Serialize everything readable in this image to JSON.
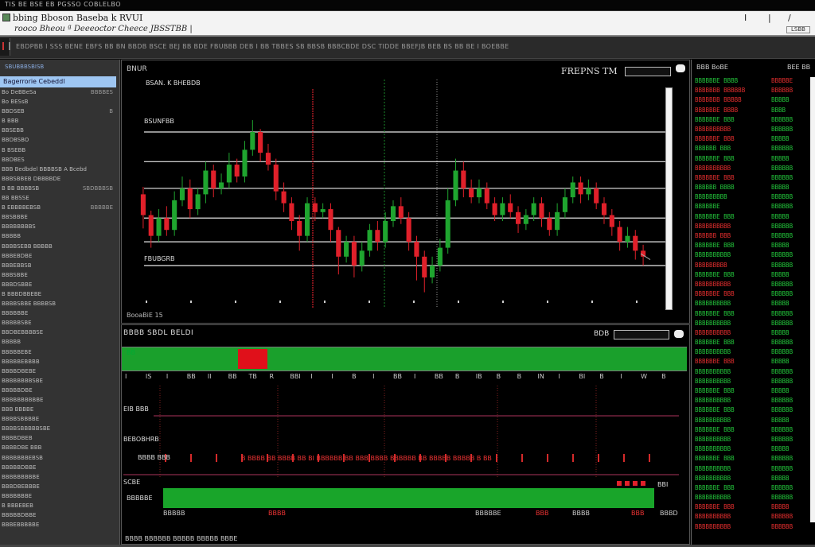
{
  "titlebar": {
    "title": "TIS  BE BSE EB PGSSO COBLELBO"
  },
  "menubar": {
    "app_name": "bbing Bboson  Baseba k  RVUI",
    "subtitle": "rooco  Bheou  ª  Deeeoctor  Cheece  JBSSTBB |",
    "win_controls": [
      "I",
      "|",
      "/"
    ],
    "small_box": "LSBB"
  },
  "toolbar": {
    "text": "EBDPBB  I  SSS  BENE  EBFS  BB  BN  BBDB  BSCE  BEJ  BB  BDE   FBUBBB  DEB   I  BB   TBBES  SB   BBSB  BBBCBDE  DSC  TIDDE  BBEFJB  BEB  BS  BB  BE  I  BOEBBE"
  },
  "sidebar": {
    "header": "SBUBBBSBISB",
    "selected": "Bagerrorie Cebeddl",
    "rows": [
      {
        "l": "Bo DeBBeSa",
        "r": "BBBBES"
      },
      {
        "l": "Bo BESsB",
        "r": ""
      },
      {
        "l": "BBDSEB",
        "r": "B"
      },
      {
        "l": "B BBB",
        "r": ""
      },
      {
        "l": "BBSEBB",
        "r": ""
      },
      {
        "l": "BBDBSBO",
        "r": ""
      },
      {
        "l": "B  BSEBB",
        "r": ""
      },
      {
        "l": "BBDBES",
        "r": ""
      },
      {
        "l": "BBB Bedbdel  BBBBSB  A Bcebd",
        "r": ""
      },
      {
        "l": "BBBSBBEB  DBBBBDE",
        "r": ""
      },
      {
        "l": "B BB BBBBSB",
        "r": "SBDBBBSB"
      },
      {
        "l": "BB BBSSE",
        "r": ""
      },
      {
        "l": "B EBBBBEBSB",
        "r": "BBBBBE"
      },
      {
        "l": "BBSBBBE",
        "r": ""
      },
      {
        "l": "BBBBBBBBS",
        "r": ""
      },
      {
        "l": "BBBBB",
        "r": ""
      },
      {
        "l": "BBBBSEBB  BBBBB",
        "r": ""
      },
      {
        "l": "BBBEBDBE",
        "r": ""
      },
      {
        "l": "BBBEBBSB",
        "r": ""
      },
      {
        "l": "BBBSBBE",
        "r": ""
      },
      {
        "l": "BBBDSBBE",
        "r": ""
      },
      {
        "l": "B BBBDBBEBE",
        "r": ""
      },
      {
        "l": "BBBBSBBE BBBBSB",
        "r": ""
      },
      {
        "l": "BBBBBBE",
        "r": ""
      },
      {
        "l": "BBBBBSBE",
        "r": ""
      },
      {
        "l": "BBDBEBBBBSE",
        "r": ""
      },
      {
        "l": "BBBBB",
        "r": ""
      },
      {
        "l": "BBBBBEBE",
        "r": ""
      },
      {
        "l": "BBBBBEBBBB",
        "r": ""
      },
      {
        "l": "BBBBDBEBE",
        "r": ""
      },
      {
        "l": "BBBBBBBBSBE",
        "r": ""
      },
      {
        "l": "BBBBBDBE",
        "r": ""
      },
      {
        "l": "BBBBBBBBBBE",
        "r": ""
      },
      {
        "l": "BBB BBBBE",
        "r": ""
      },
      {
        "l": "BBBBSBBBBE",
        "r": ""
      },
      {
        "l": "BBBBSBBBBBSBE",
        "r": ""
      },
      {
        "l": "BBBBDBEB",
        "r": ""
      },
      {
        "l": "BBBBDBE  BBB",
        "r": ""
      },
      {
        "l": "BBBBBBBEBSB",
        "r": ""
      },
      {
        "l": "BBBBBDBBE",
        "r": ""
      },
      {
        "l": "BBBBBBBBBE",
        "r": ""
      },
      {
        "l": "BBBDBEBBBE",
        "r": ""
      },
      {
        "l": "BBBBBBBE",
        "r": ""
      },
      {
        "l": "B BBBEBEB",
        "r": ""
      },
      {
        "l": "BBBBBDBBE",
        "r": ""
      },
      {
        "l": "BBBEBBBBBE",
        "r": ""
      }
    ]
  },
  "chart": {
    "title": "BNUR",
    "tag": "FREPNS  TM",
    "label_top": "BSAN. K BHEBDB",
    "level_labels": [
      "BSUNFBB",
      "FBUBGRB"
    ],
    "footer": "BooaBiE 15"
  },
  "chart_data": {
    "type": "candlestick",
    "title": "",
    "x": [],
    "ohlc": [
      [
        228,
        214,
        205,
        233
      ],
      [
        214,
        200,
        192,
        217
      ],
      [
        200,
        212,
        196,
        218
      ],
      [
        212,
        204,
        200,
        220
      ],
      [
        204,
        224,
        200,
        230
      ],
      [
        224,
        232,
        220,
        240
      ],
      [
        232,
        218,
        212,
        238
      ],
      [
        218,
        228,
        214,
        232
      ],
      [
        228,
        244,
        222,
        250
      ],
      [
        244,
        232,
        226,
        248
      ],
      [
        232,
        236,
        228,
        242
      ],
      [
        236,
        248,
        232,
        256
      ],
      [
        248,
        240,
        236,
        252
      ],
      [
        240,
        258,
        236,
        264
      ],
      [
        258,
        270,
        254,
        278
      ],
      [
        270,
        256,
        250,
        272
      ],
      [
        256,
        248,
        244,
        262
      ],
      [
        248,
        230,
        224,
        252
      ],
      [
        230,
        222,
        216,
        236
      ],
      [
        222,
        210,
        204,
        226
      ],
      [
        210,
        200,
        190,
        214
      ],
      [
        200,
        222,
        196,
        226
      ],
      [
        222,
        216,
        210,
        226
      ],
      [
        216,
        218,
        212,
        222
      ],
      [
        218,
        204,
        196,
        222
      ],
      [
        204,
        186,
        174,
        206
      ],
      [
        186,
        196,
        182,
        200
      ],
      [
        196,
        180,
        172,
        200
      ],
      [
        180,
        190,
        176,
        196
      ],
      [
        190,
        204,
        186,
        208
      ],
      [
        204,
        196,
        190,
        210
      ],
      [
        196,
        210,
        192,
        216
      ],
      [
        210,
        220,
        206,
        224
      ],
      [
        220,
        212,
        208,
        226
      ],
      [
        212,
        196,
        190,
        216
      ],
      [
        196,
        186,
        170,
        200
      ],
      [
        186,
        172,
        162,
        190
      ],
      [
        172,
        180,
        168,
        186
      ],
      [
        180,
        192,
        176,
        198
      ],
      [
        192,
        224,
        188,
        232
      ],
      [
        224,
        244,
        220,
        252
      ],
      [
        244,
        232,
        226,
        250
      ],
      [
        232,
        226,
        222,
        238
      ],
      [
        226,
        232,
        222,
        238
      ],
      [
        232,
        222,
        218,
        236
      ],
      [
        222,
        214,
        210,
        226
      ],
      [
        214,
        222,
        210,
        226
      ],
      [
        222,
        216,
        212,
        228
      ],
      [
        216,
        208,
        202,
        220
      ],
      [
        208,
        214,
        204,
        218
      ],
      [
        214,
        222,
        210,
        226
      ],
      [
        222,
        212,
        206,
        226
      ],
      [
        212,
        204,
        200,
        216
      ],
      [
        204,
        216,
        200,
        222
      ],
      [
        216,
        226,
        212,
        232
      ],
      [
        226,
        236,
        222,
        240
      ],
      [
        236,
        228,
        222,
        240
      ],
      [
        228,
        232,
        224,
        238
      ],
      [
        232,
        222,
        218,
        236
      ],
      [
        222,
        214,
        208,
        226
      ],
      [
        214,
        206,
        200,
        218
      ],
      [
        206,
        196,
        190,
        210
      ],
      [
        196,
        200,
        192,
        206
      ],
      [
        200,
        190,
        184,
        204
      ],
      [
        190,
        186,
        180,
        194
      ]
    ],
    "levels": [
      270,
      250,
      232,
      212,
      196,
      180
    ],
    "ylim": [
      150,
      300
    ],
    "grid": true
  },
  "lower": {
    "title": "BBBB  SBDL  BELDI",
    "tag": "BDB",
    "heat_label": "BB",
    "ticks": [
      "I",
      "IS",
      "I",
      "BB",
      "II",
      "BB",
      "TB",
      "R",
      "BBI",
      "I",
      "I",
      "B",
      "I",
      "BB",
      "I",
      "BB",
      "B",
      "IB",
      "B",
      "B",
      "IN",
      "I",
      "BI",
      "B",
      "I",
      "W",
      "B"
    ],
    "labels": [
      {
        "t": "EIB BBB",
        "x": 2,
        "y": 101
      },
      {
        "t": "BEBOBHRB",
        "x": 2,
        "y": 139
      },
      {
        "t": "BBBB  BBB",
        "x": 20,
        "y": 162
      },
      {
        "t": "SCBE",
        "x": 2,
        "y": 193
      },
      {
        "t": "BBBBBE",
        "x": 6,
        "y": 213
      },
      {
        "t": "BBI",
        "x": 673,
        "y": 196
      }
    ],
    "row_text": "B  BBBB  BB  BBBB  BB  BI  BBBBBB  BB  BBB  BBBB  BBBBBB  BB  BBBBB  BBBBB  B  BB",
    "footer_left": "BBBBB",
    "footer_mid": "BBBB",
    "footer_mid2": "BBBBBE",
    "footer_right1": "BBB",
    "footer_right2": "BBBB",
    "footer_right3": "BBB",
    "footer_right4": "BBBD",
    "bottom_text": "BBBB  BBBBBB  BBBBB  BBBBB  BBBE"
  },
  "rightpanel": {
    "header_left": "BBB BoBE",
    "header_right": "BEE  BB",
    "col_a": [
      {
        "t": "BBBBBBE BBBB",
        "d": "up"
      },
      {
        "t": "BBBBBBB BBBBBB",
        "d": "dn"
      },
      {
        "t": "BBBBBBB BBBBB",
        "d": "dn"
      },
      {
        "t": "BBBBBBE BBBB",
        "d": "dn"
      },
      {
        "t": "BBBBBBE  BBB",
        "d": "up"
      },
      {
        "t": "BBBBBBBBBB",
        "d": "dn"
      },
      {
        "t": "BBBBBBE  BBB",
        "d": "dn"
      },
      {
        "t": "BBBBBB  BBB",
        "d": "up"
      },
      {
        "t": "BBBBBBE BBB",
        "d": "up"
      },
      {
        "t": "BBBBBBBBBB",
        "d": "dn"
      },
      {
        "t": "BBBBBBE BBB",
        "d": "dn"
      },
      {
        "t": "BBBBBB BBBB",
        "d": "up"
      },
      {
        "t": "BBBBBBBBB",
        "d": "up"
      },
      {
        "t": "BBBBBBE",
        "d": "up"
      },
      {
        "t": "BBBBBBE BBB",
        "d": "up"
      },
      {
        "t": "BBBBBBBBBB",
        "d": "dn"
      },
      {
        "t": "BBBBBB BBB",
        "d": "dn"
      },
      {
        "t": "BBBBBBE BBB",
        "d": "up"
      },
      {
        "t": "BBBBBBBBBB",
        "d": "up"
      },
      {
        "t": "BBBBBBBBB",
        "d": "dn"
      },
      {
        "t": "BBBBBBE BBB",
        "d": "up"
      },
      {
        "t": "BBBBBBBBBB",
        "d": "dn"
      },
      {
        "t": "BBBBBBE BBB",
        "d": "dn"
      },
      {
        "t": "BBBBBBBBBB",
        "d": "up"
      },
      {
        "t": "BBBBBBE BBB",
        "d": "up"
      },
      {
        "t": "BBBBBBBBBB",
        "d": "up"
      },
      {
        "t": "BBBBBBBBBB",
        "d": "dn"
      },
      {
        "t": "BBBBBBE BBB",
        "d": "up"
      },
      {
        "t": "BBBBBBBBBB",
        "d": "up"
      },
      {
        "t": "BBBBBBE BBB",
        "d": "dn"
      },
      {
        "t": "BBBBBBBBBB",
        "d": "up"
      },
      {
        "t": "BBBBBBBBBB",
        "d": "up"
      },
      {
        "t": "BBBBBBE BBB",
        "d": "up"
      },
      {
        "t": "BBBBBBBBBB",
        "d": "up"
      },
      {
        "t": "BBBBBBE BBB",
        "d": "up"
      },
      {
        "t": "BBBBBBBBBB",
        "d": "up"
      },
      {
        "t": "BBBBBBE BBB",
        "d": "up"
      },
      {
        "t": "BBBBBBBBBB",
        "d": "up"
      },
      {
        "t": "BBBBBBBBBB",
        "d": "up"
      },
      {
        "t": "BBBBBBE BBB",
        "d": "up"
      },
      {
        "t": "BBBBBBBBBB",
        "d": "up"
      },
      {
        "t": "BBBBBBBBBB",
        "d": "up"
      },
      {
        "t": "BBBBBBE BBB",
        "d": "up"
      },
      {
        "t": "BBBBBBBBBB",
        "d": "up"
      },
      {
        "t": "BBBBBBE BBB",
        "d": "dn"
      },
      {
        "t": "BBBBBBBBBB",
        "d": "dn"
      },
      {
        "t": "BBBBBBBBBB",
        "d": "dn"
      }
    ],
    "col_b": [
      {
        "t": "BBBBBE",
        "d": "dn"
      },
      {
        "t": "BBBBBB",
        "d": "dn"
      },
      {
        "t": "BBBBB",
        "d": "up"
      },
      {
        "t": "BBBB",
        "d": "up"
      },
      {
        "t": "BBBBBB",
        "d": "up"
      },
      {
        "t": "BBBBBB",
        "d": "up"
      },
      {
        "t": "BBBBB",
        "d": "up"
      },
      {
        "t": "BBBBBB",
        "d": "up"
      },
      {
        "t": "BBBBB",
        "d": "up"
      },
      {
        "t": "BBBBBB",
        "d": "up"
      },
      {
        "t": "BBBBBB",
        "d": "up"
      },
      {
        "t": "BBBBB",
        "d": "up"
      },
      {
        "t": "BBBBBB",
        "d": "up"
      },
      {
        "t": "BBBBBB",
        "d": "up"
      },
      {
        "t": "BBBBB",
        "d": "up"
      },
      {
        "t": "BBBBBB",
        "d": "up"
      },
      {
        "t": "BBBBBB",
        "d": "up"
      },
      {
        "t": "BBBBB",
        "d": "up"
      },
      {
        "t": "BBBBBB",
        "d": "up"
      },
      {
        "t": "BBBBBB",
        "d": "up"
      },
      {
        "t": "BBBBB",
        "d": "up"
      },
      {
        "t": "BBBBBB",
        "d": "up"
      },
      {
        "t": "BBBBBB",
        "d": "up"
      },
      {
        "t": "BBBBB",
        "d": "up"
      },
      {
        "t": "BBBBBB",
        "d": "up"
      },
      {
        "t": "BBBBBB",
        "d": "up"
      },
      {
        "t": "BBBBB",
        "d": "up"
      },
      {
        "t": "BBBBBB",
        "d": "up"
      },
      {
        "t": "BBBBBB",
        "d": "up"
      },
      {
        "t": "BBBBB",
        "d": "up"
      },
      {
        "t": "BBBBBB",
        "d": "up"
      },
      {
        "t": "BBBBBB",
        "d": "up"
      },
      {
        "t": "BBBBB",
        "d": "up"
      },
      {
        "t": "BBBBBB",
        "d": "up"
      },
      {
        "t": "BBBBBB",
        "d": "up"
      },
      {
        "t": "BBBBB",
        "d": "up"
      },
      {
        "t": "BBBBBB",
        "d": "up"
      },
      {
        "t": "BBBBBB",
        "d": "up"
      },
      {
        "t": "BBBBB",
        "d": "up"
      },
      {
        "t": "BBBBBB",
        "d": "up"
      },
      {
        "t": "BBBBBB",
        "d": "up"
      },
      {
        "t": "BBBBB",
        "d": "up"
      },
      {
        "t": "BBBBBB",
        "d": "up"
      },
      {
        "t": "BBBBBB",
        "d": "up"
      },
      {
        "t": "BBBBB",
        "d": "dn"
      },
      {
        "t": "BBBBBB",
        "d": "dn"
      },
      {
        "t": "BBBBBB",
        "d": "dn"
      }
    ]
  },
  "colors": {
    "up": "#1fa52f",
    "down": "#e0202a",
    "bg": "#000000",
    "panel": "#333333"
  }
}
